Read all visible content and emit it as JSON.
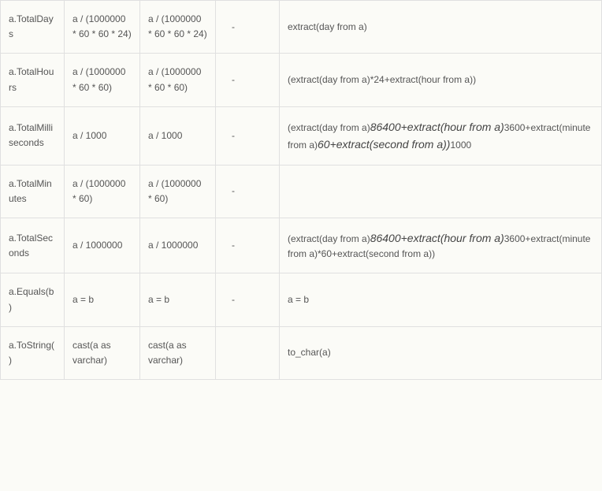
{
  "rows": [
    {
      "c0": "a.TotalDays",
      "c1": "a / (1000000 * 60 * 60 * 24)",
      "c2": "a / (1000000 * 60 * 60 * 24)",
      "c3": "-",
      "c4": [
        {
          "t": "extract(day from a)",
          "i": false
        }
      ]
    },
    {
      "c0": "a.TotalHours",
      "c1": "a / (1000000 * 60 * 60)",
      "c2": "a / (1000000 * 60 * 60)",
      "c3": "-",
      "c4": [
        {
          "t": "(extract(day from a)*24+extract(hour from a))",
          "i": false
        }
      ]
    },
    {
      "c0": "a.TotalMilliseconds",
      "c1": "a / 1000",
      "c2": "a / 1000",
      "c3": "-",
      "c4": [
        {
          "t": "(extract(day from a)",
          "i": false
        },
        {
          "t": "86400+extract(hour from a)",
          "i": true
        },
        {
          "t": "3600+extract(minute from a)",
          "i": false
        },
        {
          "t": "60+extract(second from a))",
          "i": true
        },
        {
          "t": "1000",
          "i": false
        }
      ]
    },
    {
      "c0": "a.TotalMinutes",
      "c1": "a / (1000000 * 60)",
      "c2": "a / (1000000 * 60)",
      "c3": "-",
      "c4": [
        {
          "t": "",
          "i": false
        }
      ]
    },
    {
      "c0": "a.TotalSeconds",
      "c1": "a / 1000000",
      "c2": "a / 1000000",
      "c3": "-",
      "c4": [
        {
          "t": "(extract(day from a)",
          "i": false
        },
        {
          "t": "86400+extract(hour from a)",
          "i": true
        },
        {
          "t": "3600+extract(minute from a)*60+extract(second from a))",
          "i": false
        }
      ]
    },
    {
      "c0": "a.Equals(b)",
      "c1": "a = b",
      "c2": "a = b",
      "c3": "-",
      "c4": [
        {
          "t": "a = b",
          "i": false
        }
      ]
    },
    {
      "c0": "a.ToString()",
      "c1": "cast(a as varchar)",
      "c2": "cast(a as varchar)",
      "c3": "",
      "c4": [
        {
          "t": "to_char(a)",
          "i": false
        }
      ]
    }
  ]
}
